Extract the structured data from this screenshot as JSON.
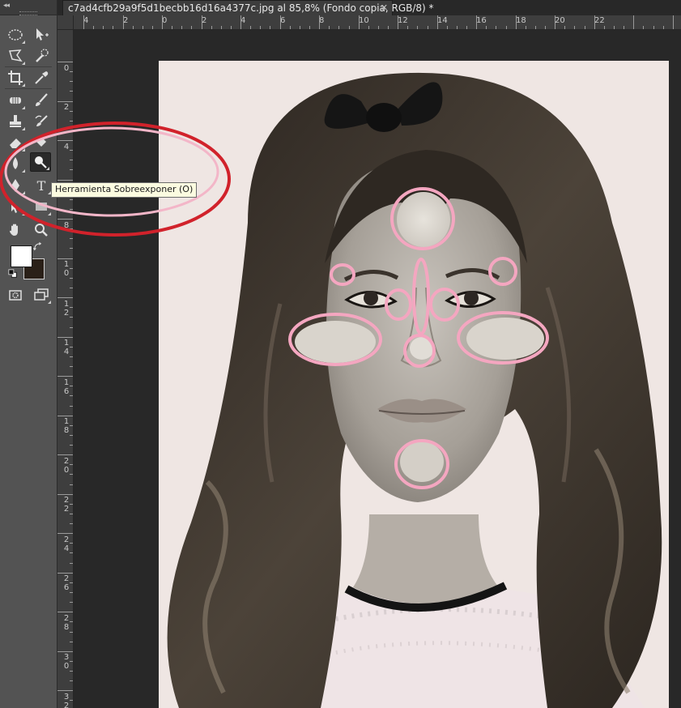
{
  "document": {
    "tab_title": "c7ad4cfb29a9f5d1becbb16d16a4377c.jpg al 85,8% (Fondo copia, RGB/8) *",
    "close_glyph": "✕"
  },
  "toolbar": {
    "collapse_glyph": "◂◂",
    "tools": [
      {
        "name": "elliptical-marquee-tool-icon"
      },
      {
        "name": "move-tool-icon"
      },
      {
        "name": "polygonal-lasso-tool-icon"
      },
      {
        "name": "quick-selection-tool-icon"
      },
      {
        "name": "crop-tool-icon"
      },
      {
        "name": "eyedropper-tool-icon"
      },
      {
        "name": "spot-healing-brush-icon"
      },
      {
        "name": "brush-tool-icon"
      },
      {
        "name": "clone-stamp-tool-icon"
      },
      {
        "name": "history-brush-icon"
      },
      {
        "name": "eraser-tool-icon"
      },
      {
        "name": "paint-bucket-tool-icon"
      },
      {
        "name": "blur-tool-icon"
      },
      {
        "name": "dodge-tool-icon",
        "active": true
      },
      {
        "name": "pen-tool-icon"
      },
      {
        "name": "type-tool-icon",
        "glyph": "T"
      },
      {
        "name": "path-selection-tool-icon"
      },
      {
        "name": "rectangle-tool-icon"
      },
      {
        "name": "hand-tool-icon"
      },
      {
        "name": "zoom-tool-icon"
      }
    ],
    "foreground_color": "#ffffff",
    "background_color": "#2a2018"
  },
  "tooltip": {
    "text": "Herramienta Sobreexponer (O)"
  },
  "ruler": {
    "horizontal_labels": [
      "4",
      "2",
      "0",
      "2",
      "4",
      "6",
      "8",
      "10",
      "12",
      "14",
      "16",
      "18",
      "20",
      "22"
    ],
    "vertical_labels": [
      "0",
      "2",
      "4",
      "6",
      "8",
      "10",
      "12",
      "14",
      "16",
      "18",
      "20",
      "22",
      "24",
      "26",
      "28",
      "30",
      "32"
    ]
  },
  "colors": {
    "annotation_red": "#d1222b",
    "annotation_pink": "#f3b6c8",
    "highlight_pink": "#f4a6c0"
  }
}
